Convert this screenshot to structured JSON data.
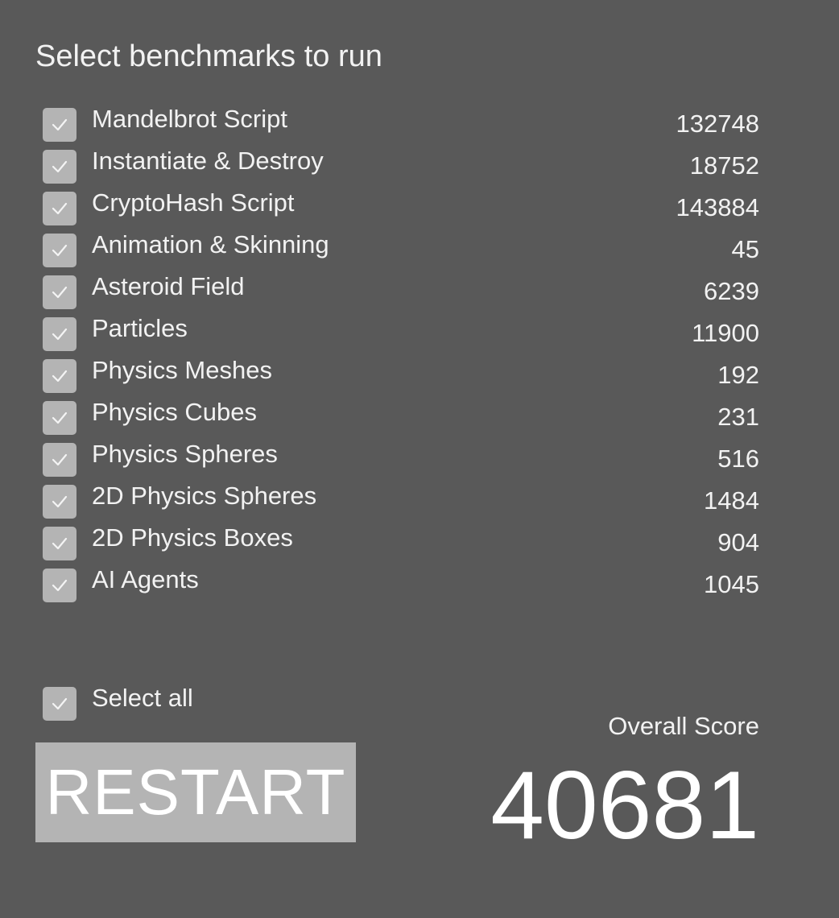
{
  "heading": "Select benchmarks to run",
  "benchmarks": [
    {
      "label": "Mandelbrot Script",
      "score": "132748",
      "checked": true
    },
    {
      "label": "Instantiate & Destroy",
      "score": "18752",
      "checked": true
    },
    {
      "label": "CryptoHash Script",
      "score": "143884",
      "checked": true
    },
    {
      "label": "Animation & Skinning",
      "score": "45",
      "checked": true
    },
    {
      "label": "Asteroid Field",
      "score": "6239",
      "checked": true
    },
    {
      "label": "Particles",
      "score": "11900",
      "checked": true
    },
    {
      "label": "Physics Meshes",
      "score": "192",
      "checked": true
    },
    {
      "label": "Physics Cubes",
      "score": "231",
      "checked": true
    },
    {
      "label": "Physics Spheres",
      "score": "516",
      "checked": true
    },
    {
      "label": "2D Physics Spheres",
      "score": "1484",
      "checked": true
    },
    {
      "label": "2D Physics Boxes",
      "score": "904",
      "checked": true
    },
    {
      "label": "AI Agents",
      "score": "1045",
      "checked": true
    }
  ],
  "select_all": {
    "label": "Select all",
    "checked": true
  },
  "restart_label": "RESTART",
  "overall": {
    "label": "Overall Score",
    "value": "40681"
  },
  "colors": {
    "background": "#595959",
    "checkbox": "#b4b4b4",
    "button": "#b4b4b4",
    "text": "#f2f2f2"
  },
  "icons": {
    "checkbox_mark": "check-icon"
  }
}
